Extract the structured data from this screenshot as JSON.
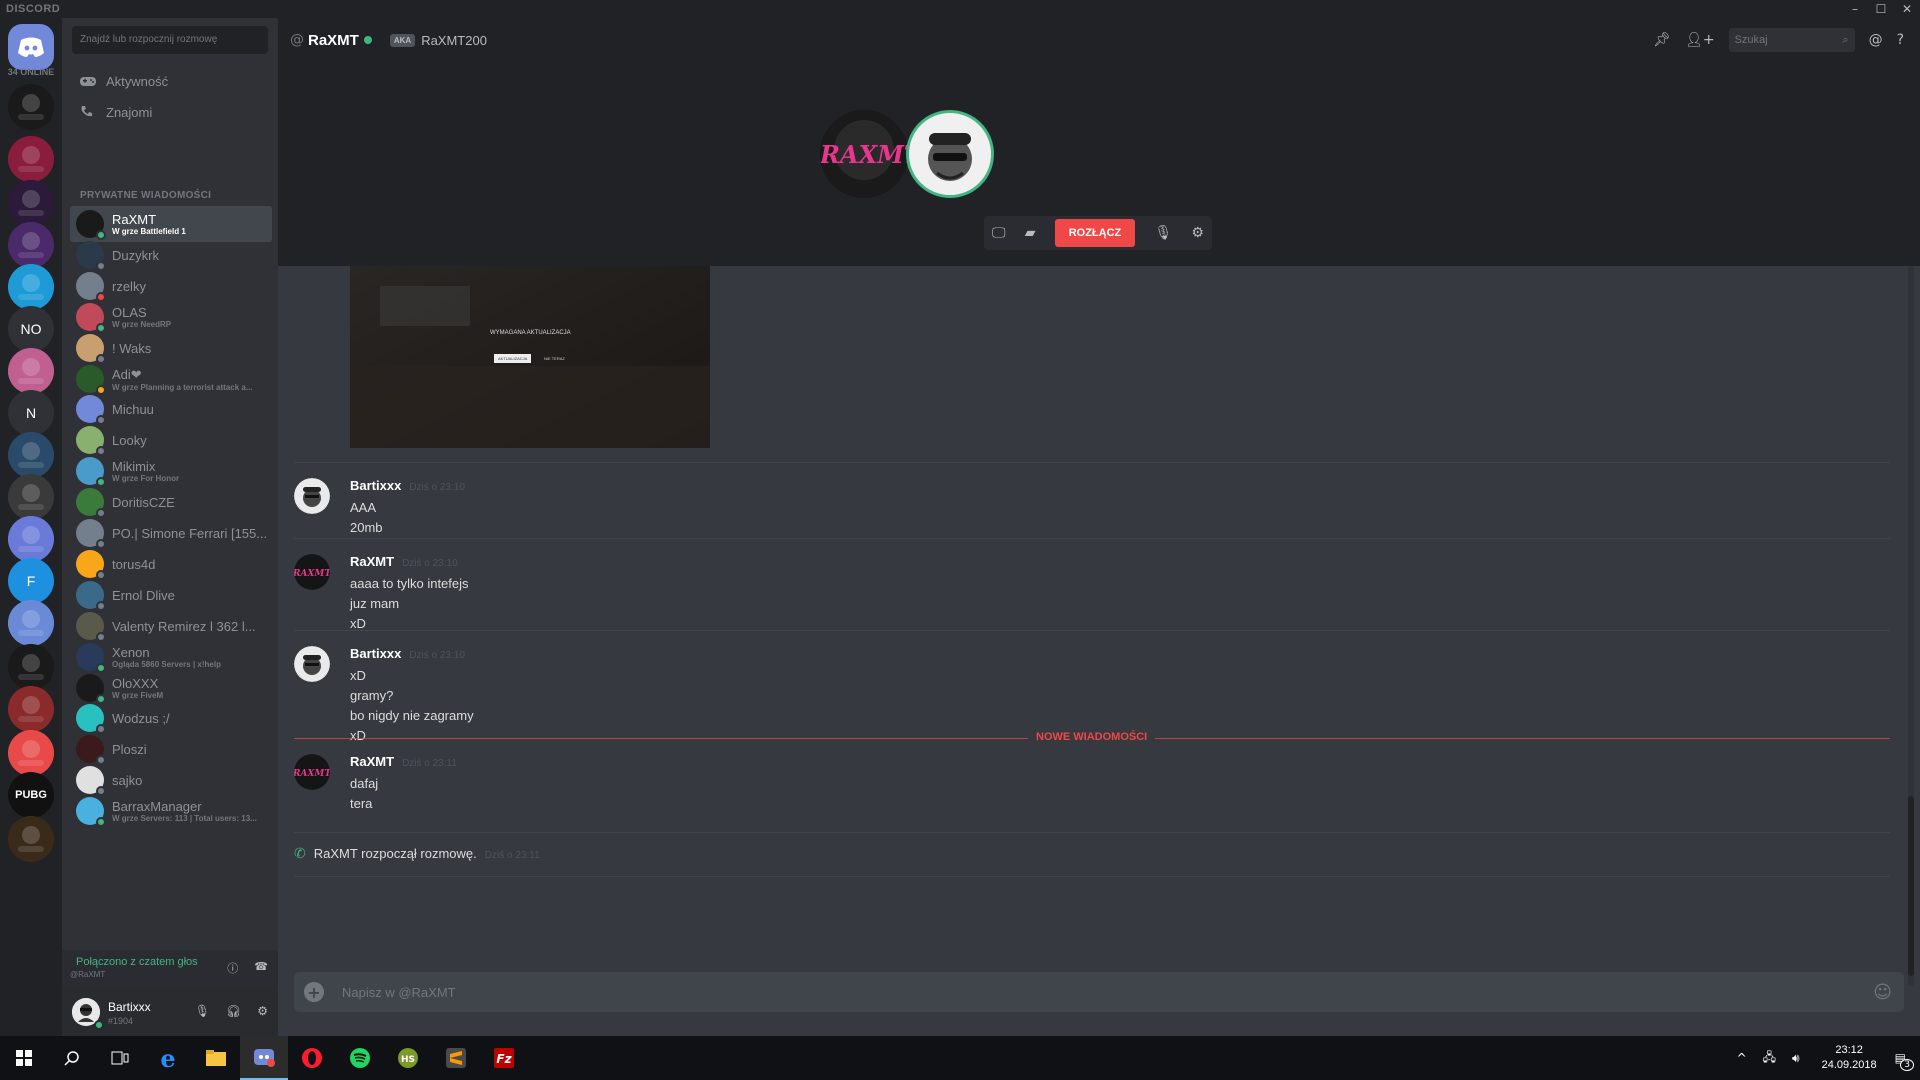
{
  "titlebar": {
    "brand": "DISCORD"
  },
  "guilds": {
    "online_count": "34 ONLINE",
    "items": [
      {
        "label": "",
        "color": "#7289da",
        "icon": "discord-logo-icon"
      },
      {
        "label": "",
        "color": "#1a1a1a",
        "icon": "raxmt-server-icon"
      },
      {
        "label": "",
        "color": "#8a1c3c",
        "icon": "server-icon"
      },
      {
        "label": "",
        "color": "#2b1a3a",
        "icon": "server-icon"
      },
      {
        "label": "",
        "color": "#4a2a6a",
        "icon": "server-icon"
      },
      {
        "label": "",
        "color": "#1e9bd7",
        "icon": "server-icon"
      },
      {
        "label": "NO",
        "color": "#2f3136"
      },
      {
        "label": "",
        "color": "#c06090",
        "icon": "server-icon"
      },
      {
        "label": "N",
        "color": "#2f3136"
      },
      {
        "label": "",
        "color": "#2a4a6a",
        "icon": "server-icon"
      },
      {
        "label": "",
        "color": "#3a3a3a",
        "icon": "server-icon"
      },
      {
        "label": "",
        "color": "#6a7ad8",
        "icon": "server-icon"
      },
      {
        "label": "F",
        "color": "#1e90e0"
      },
      {
        "label": "",
        "color": "#6a8ad8",
        "icon": "server-icon"
      },
      {
        "label": "",
        "color": "#1a1a1a",
        "icon": "server-icon"
      },
      {
        "label": "",
        "color": "#8a2a2a",
        "icon": "server-icon"
      },
      {
        "label": "",
        "color": "#e84a4a",
        "icon": "server-icon"
      },
      {
        "label": "PUBG",
        "color": "#111111"
      },
      {
        "label": "",
        "color": "#3a2a1a",
        "icon": "server-icon"
      }
    ]
  },
  "dm_panel": {
    "search_placeholder": "Znajdź lub rozpocznij rozmowę",
    "activity_label": "Aktywność",
    "friends_label": "Znajomi",
    "section_header": "PRYWATNE WIADOMOŚCI",
    "items": [
      {
        "name": "RaXMT",
        "sub": "W grze Battlefield 1",
        "status": "#43b581",
        "avatar": "#1a1a1a",
        "active": true
      },
      {
        "name": "Duzykrk",
        "sub": "",
        "status": "#747f8d",
        "avatar": "#2a3a4a"
      },
      {
        "name": "rzelky",
        "sub": "",
        "status": "#f04747",
        "avatar": "#747f8d"
      },
      {
        "name": "OLAS",
        "sub": "W grze NeedRP",
        "status": "#43b581",
        "avatar": "#c04a5a"
      },
      {
        "name": "! Waks",
        "sub": "",
        "status": "#747f8d",
        "avatar": "#c8a070"
      },
      {
        "name": "Adi❤",
        "sub": "W grze Planning a terrorist attack a...",
        "status": "#faa61a",
        "avatar": "#2a5a2a"
      },
      {
        "name": "Michuu",
        "sub": "",
        "status": "#747f8d",
        "avatar": "#7289da"
      },
      {
        "name": "Looky",
        "sub": "",
        "status": "#747f8d",
        "avatar": "#8ab070"
      },
      {
        "name": "Mikimix",
        "sub": "W grze For Honor",
        "status": "#43b581",
        "avatar": "#4a9aca"
      },
      {
        "name": "DoritisCZE",
        "sub": "",
        "status": "#747f8d",
        "avatar": "#3a7a3a"
      },
      {
        "name": "PO.| Simone Ferrari [155...",
        "sub": "",
        "status": "#747f8d",
        "avatar": "#747f8d"
      },
      {
        "name": "torus4d",
        "sub": "",
        "status": "#747f8d",
        "avatar": "#faa61a"
      },
      {
        "name": "Ernol Dlive",
        "sub": "",
        "status": "#747f8d",
        "avatar": "#3a6a8a"
      },
      {
        "name": "Valenty Remirez l 362 l...",
        "sub": "",
        "status": "#747f8d",
        "avatar": "#5a5a4a"
      },
      {
        "name": "Xenon",
        "sub": "Ogląda 5860 Servers | x!help",
        "status": "#43b581",
        "avatar": "#2a3a5a"
      },
      {
        "name": "OloXXX",
        "sub": "W grze FiveM",
        "status": "#43b581",
        "avatar": "#1a1a1a"
      },
      {
        "name": "Wodzus ;/",
        "sub": "",
        "status": "#747f8d",
        "avatar": "#2ac0c0"
      },
      {
        "name": "Ploszi",
        "sub": "",
        "status": "#747f8d",
        "avatar": "#3a1a1a"
      },
      {
        "name": "sajko",
        "sub": "",
        "status": "#747f8d",
        "avatar": "#e0e0e0"
      },
      {
        "name": "BarraxManager",
        "sub": "W grze Servers: 113 | Total users: 13...",
        "status": "#43b581",
        "avatar": "#4ab0e0"
      }
    ]
  },
  "voice_panel": {
    "title": "Połączono z czatem głos",
    "subtitle": "@RaXMT"
  },
  "user_panel": {
    "name": "Bartixxx",
    "tag": "#1904"
  },
  "header": {
    "at": "@",
    "title": "RaXMT",
    "aka_badge": "AKA",
    "aka_name": "RaXMT200",
    "search_placeholder": "Szukaj"
  },
  "call": {
    "disconnect_label": "ROZŁĄCZ",
    "raxmt_logo": "RAXMT"
  },
  "messages": [
    {
      "author": "Bartixxx",
      "time": "Dziś o 23:10",
      "lines": [
        "AAA",
        "20mb"
      ],
      "avatar": "bartixxx"
    },
    {
      "author": "RaXMT",
      "time": "Dziś o 23:10",
      "lines": [
        "aaaa to tylko intefejs",
        "juz mam",
        "xD"
      ],
      "avatar": "raxmt"
    },
    {
      "author": "Bartixxx",
      "time": "Dziś o 23:10",
      "lines": [
        "xD",
        "gramy?",
        "bo nigdy nie zagramy",
        "xD"
      ],
      "avatar": "bartixxx"
    },
    {
      "author": "RaXMT",
      "time": "Dziś o 23:11",
      "lines": [
        "dafaj",
        "tera"
      ],
      "avatar": "raxmt"
    }
  ],
  "embed_image": {
    "caption": "WYMAGANA AKTUALIZACJA",
    "button1": "AKTUALIZACJA",
    "button2": "NIE TERAZ"
  },
  "new_messages_label": "NOWE WIADOMOŚCI",
  "call_log": {
    "text": "RaXMT rozpoczął rozmowę.",
    "time": "Dziś o 23:11"
  },
  "composer": {
    "placeholder": "Napisz w @RaXMT"
  },
  "taskbar": {
    "time": "23:12",
    "date": "24.09.2018",
    "notifications": "3"
  }
}
